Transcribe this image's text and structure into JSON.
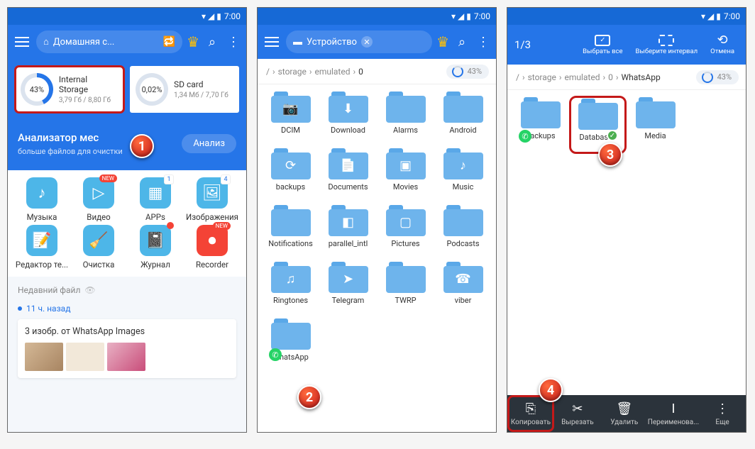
{
  "status": {
    "time": "7:00"
  },
  "panel1": {
    "pill": "Домашняя с...",
    "storage1": {
      "pct": "43%",
      "title": "Internal Storage",
      "sub": "3,79 Гб / 8,80 Гб"
    },
    "storage2": {
      "pct": "0,02%",
      "title": "SD card",
      "sub": "1,34 Мб / 7,70 Гб"
    },
    "analyzer": {
      "title": "Анализатор мес",
      "sub": "больше файлов для очистки",
      "btn": "Анализ"
    },
    "apps": [
      {
        "label": "Музыка",
        "badge": ""
      },
      {
        "label": "Видео",
        "badge": "NEW"
      },
      {
        "label": "APPs",
        "badge": "1"
      },
      {
        "label": "Изображения",
        "badge": "4"
      },
      {
        "label": "Редактор те...",
        "badge": ""
      },
      {
        "label": "Очистка",
        "badge": ""
      },
      {
        "label": "Журнал",
        "badge": "●"
      },
      {
        "label": "Recorder",
        "badge": "NEW"
      }
    ],
    "recent": "Недавний файл",
    "timeago": "11 ч. назад",
    "recentcard": "3 изобр. от WhatsApp Images"
  },
  "panel2": {
    "pill": "Устройство",
    "crumbs": [
      "/",
      "storage",
      "emulated",
      "0"
    ],
    "disk": "43%",
    "folders": [
      {
        "label": "DCIM",
        "glyph": "📷"
      },
      {
        "label": "Download",
        "glyph": "⬇"
      },
      {
        "label": "Alarms",
        "glyph": ""
      },
      {
        "label": "Android",
        "glyph": ""
      },
      {
        "label": "backups",
        "glyph": "⟳"
      },
      {
        "label": "Documents",
        "glyph": "📄"
      },
      {
        "label": "Movies",
        "glyph": "▣"
      },
      {
        "label": "Music",
        "glyph": "♪"
      },
      {
        "label": "Notifications",
        "glyph": ""
      },
      {
        "label": "parallel_intl",
        "glyph": "◧"
      },
      {
        "label": "Pictures",
        "glyph": "▢"
      },
      {
        "label": "Podcasts",
        "glyph": ""
      },
      {
        "label": "Ringtones",
        "glyph": "♫"
      },
      {
        "label": "Telegram",
        "glyph": "➤"
      },
      {
        "label": "TWRP",
        "glyph": ""
      },
      {
        "label": "viber",
        "glyph": "☎"
      },
      {
        "label": "WhatsApp",
        "glyph": "",
        "wa": true
      }
    ]
  },
  "panel3": {
    "count": "1/3",
    "actions": {
      "all": "Выбрать все",
      "range": "Выберите интервал",
      "cancel": "Отмена"
    },
    "crumbs": [
      "/",
      "storage",
      "emulated",
      "0",
      "WhatsApp"
    ],
    "disk": "43%",
    "folders": [
      {
        "label": "Backups",
        "wa": true
      },
      {
        "label": "Databases",
        "sel": true
      },
      {
        "label": "Media"
      }
    ],
    "bottom": {
      "copy": "Копировать",
      "cut": "Вырезать",
      "del": "Удалить",
      "ren": "Переименова...",
      "more": "Еще"
    }
  }
}
